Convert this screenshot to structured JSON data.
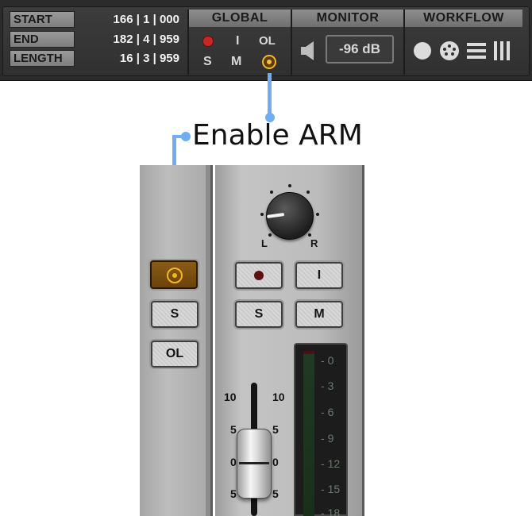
{
  "transport": {
    "counters": [
      {
        "label": "START",
        "value": "166 | 1 | 000"
      },
      {
        "label": "END",
        "value": "182 | 4 | 959"
      },
      {
        "label": "LENGTH",
        "value": "16 | 3 | 959"
      }
    ],
    "global": {
      "title": "GLOBAL",
      "record_icon": "record-dot-icon",
      "input_label": "I",
      "online_label": "OL",
      "solo_label": "S",
      "mute_label": "M",
      "arm_icon": "arm-ring-icon"
    },
    "monitor": {
      "title": "MONITOR",
      "speaker_icon": "speaker-icon",
      "level": "-96 dB"
    },
    "workflow": {
      "title": "WORKFLOW",
      "icons": [
        "circle-icon",
        "midi-icon",
        "list-icon",
        "mixer-icon"
      ]
    }
  },
  "callout": {
    "text": "Enable ARM",
    "color": "#6faef2"
  },
  "strip": {
    "left": {
      "arm_icon": "arm-ring-icon",
      "solo_label": "S",
      "online_label": "OL"
    },
    "pan": {
      "left_label": "L",
      "right_label": "R"
    },
    "record_icon": "record-dot-icon",
    "input_label": "I",
    "solo_label": "S",
    "mute_label": "M",
    "fader_scale": {
      "left": [
        "10",
        "5",
        "0",
        "5"
      ],
      "right": [
        "10",
        "5",
        "0",
        "5"
      ]
    },
    "meter_scale": [
      "0",
      "3",
      "6",
      "9",
      "12",
      "15",
      "18"
    ]
  },
  "colors": {
    "arm_accent": "#f4b52a",
    "record_red": "#c62828",
    "panel_dark": "#2b2b2b",
    "strip_grey": "#bdbdbd"
  }
}
